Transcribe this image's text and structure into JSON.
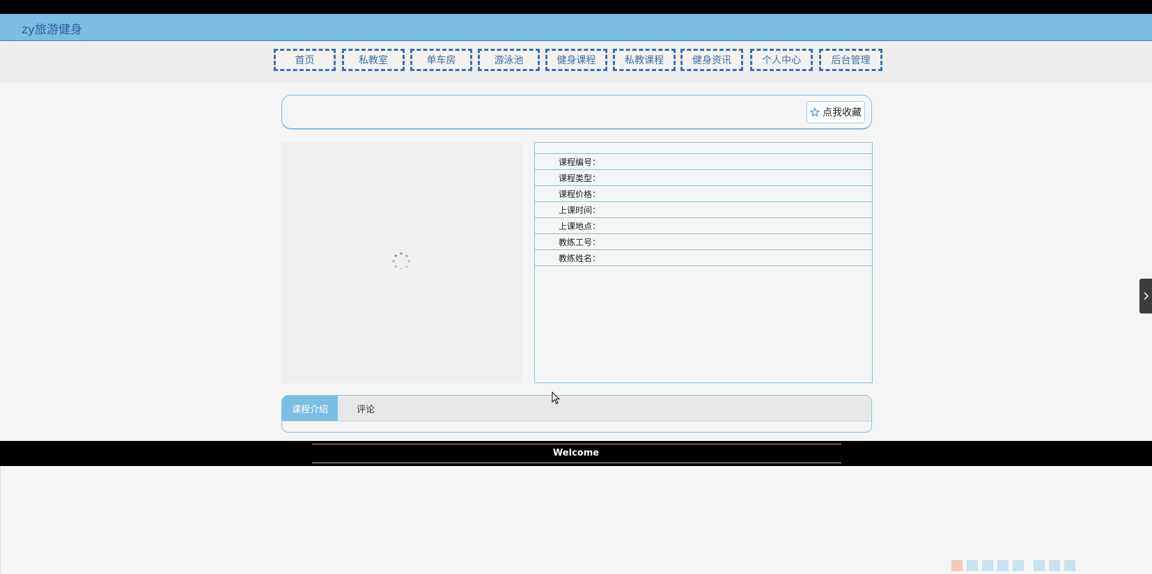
{
  "header": {
    "brand": "zy旅游健身"
  },
  "nav": {
    "items": [
      {
        "label": "首页"
      },
      {
        "label": "私教室"
      },
      {
        "label": "单车房"
      },
      {
        "label": "游泳池"
      },
      {
        "label": "健身课程"
      },
      {
        "label": "私教课程"
      },
      {
        "label": "健身资讯"
      },
      {
        "label": "个人中心"
      },
      {
        "label": "后台管理"
      }
    ]
  },
  "favorite": {
    "label": "点我收藏",
    "icon": "star-outline-icon"
  },
  "details": {
    "fields": [
      {
        "label": "课程编号：",
        "value": ""
      },
      {
        "label": "课程类型：",
        "value": ""
      },
      {
        "label": "课程价格：",
        "value": ""
      },
      {
        "label": "上课时间：",
        "value": ""
      },
      {
        "label": "上课地点：",
        "value": ""
      },
      {
        "label": "教练工号：",
        "value": ""
      },
      {
        "label": "教练姓名：",
        "value": ""
      }
    ]
  },
  "tabs": {
    "items": [
      {
        "label": "课程介绍",
        "active": true
      },
      {
        "label": "评论",
        "active": false
      }
    ]
  },
  "footer": {
    "text": "Welcome"
  },
  "colors": {
    "header_bg": "#7cbde3",
    "accent": "#3f6fa3",
    "tab_active": "#7cbde3"
  }
}
